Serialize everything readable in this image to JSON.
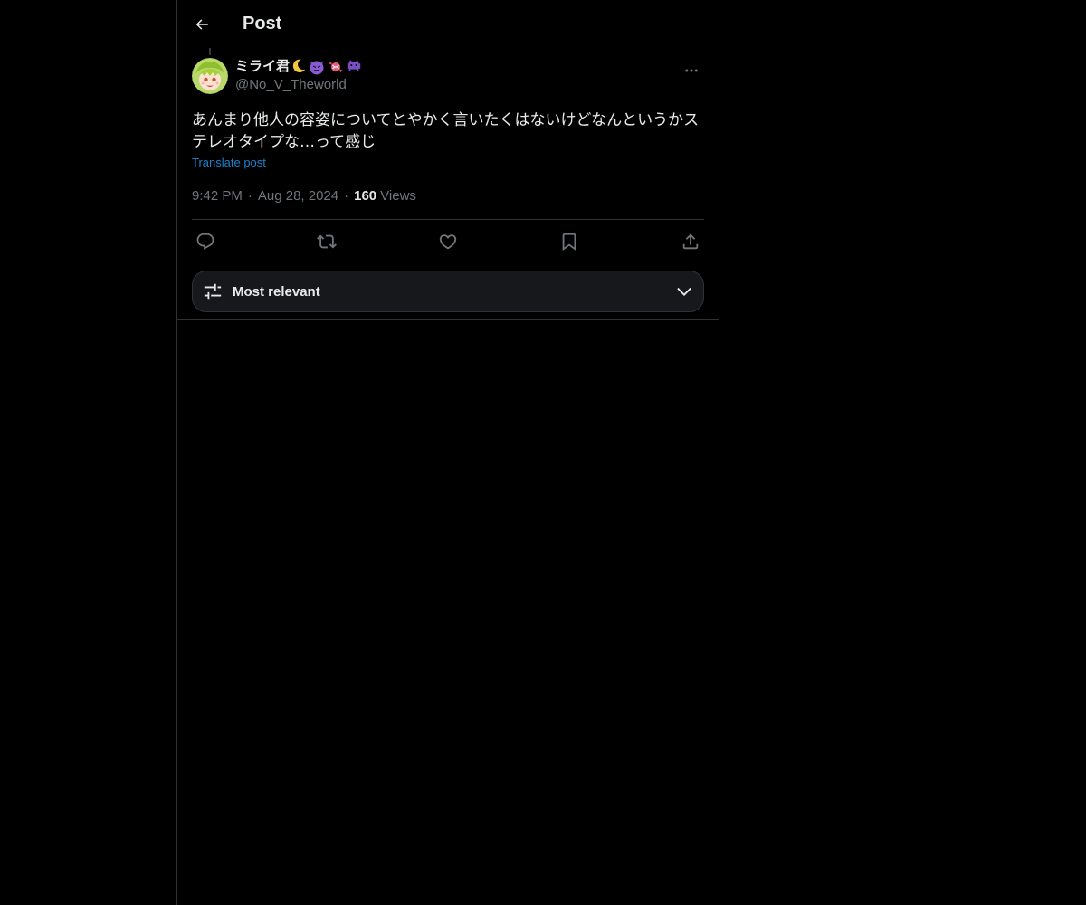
{
  "header": {
    "title": "Post",
    "back_icon": "arrow-left-icon"
  },
  "post": {
    "author": {
      "display_name": "ミライ君",
      "name_emojis": [
        "crescent-moon-icon",
        "smiling-devil-icon",
        "candy-icon",
        "space-invader-icon"
      ],
      "handle": "@No_V_Theworld"
    },
    "text": "あんまり他人の容姿についてとやかく言いたくはないけどなんというかステレオタイプな…って感じ",
    "translate_label": "Translate post",
    "time": "9:42 PM",
    "date": "Aug 28, 2024",
    "views_count": "160",
    "views_label": "Views"
  },
  "actions": [
    "reply-icon",
    "repost-icon",
    "like-icon",
    "bookmark-icon",
    "share-icon"
  ],
  "sort": {
    "label": "Most relevant",
    "icon": "sliders-icon"
  },
  "colors": {
    "background": "#000000",
    "text": "#e7e9ea",
    "secondary": "#71767b",
    "accent": "#1d9bf0",
    "border": "#2f3336"
  }
}
